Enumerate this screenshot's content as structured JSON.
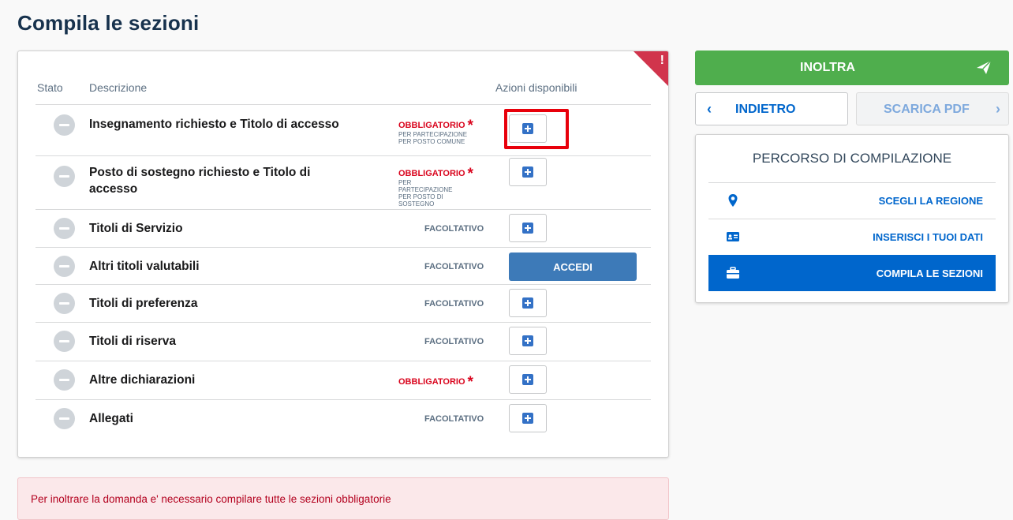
{
  "page": {
    "title": "Compila le sezioni"
  },
  "table": {
    "headers": {
      "stato": "Stato",
      "descrizione": "Descrizione",
      "azioni": "Azioni disponibili"
    },
    "rows": [
      {
        "label": "Insegnamento richiesto e Titolo di accesso",
        "tag": "OBBLIGATORIO",
        "required": true,
        "note": "PER PARTECIPAZIONE PER POSTO COMUNE",
        "action": "add",
        "highlighted": true
      },
      {
        "label": "Posto di sostegno richiesto e Titolo di accesso",
        "tag": "OBBLIGATORIO",
        "required": true,
        "note": "PER PARTECIPAZIONE PER POSTO DI SOSTEGNO",
        "action": "add"
      },
      {
        "label": "Titoli di Servizio",
        "tag": "FACOLTATIVO",
        "required": false,
        "action": "add"
      },
      {
        "label": "Altri titoli valutabili",
        "tag": "FACOLTATIVO",
        "required": false,
        "action": "button",
        "action_label": "ACCEDI"
      },
      {
        "label": "Titoli di preferenza",
        "tag": "FACOLTATIVO",
        "required": false,
        "action": "add"
      },
      {
        "label": "Titoli di riserva",
        "tag": "FACOLTATIVO",
        "required": false,
        "action": "add"
      },
      {
        "label": "Altre dichiarazioni",
        "tag": "OBBLIGATORIO",
        "required": true,
        "action": "add"
      },
      {
        "label": "Allegati",
        "tag": "FACOLTATIVO",
        "required": false,
        "action": "add"
      }
    ]
  },
  "required_star": "*",
  "corner_mark": "!",
  "alert": {
    "text": "Per inoltrare la domanda e' necessario compilare tutte le sezioni obbligatorie"
  },
  "sidebar": {
    "inoltra_label": "INOLTRA",
    "indietro_label": "INDIETRO",
    "scarica_label": "SCARICA PDF",
    "path_title": "PERCORSO DI COMPILAZIONE",
    "steps": [
      {
        "label": "SCEGLI LA REGIONE",
        "icon": "map-pin-icon",
        "active": false
      },
      {
        "label": "INSERISCI I TUOI DATI",
        "icon": "id-card-icon",
        "active": false
      },
      {
        "label": "COMPILA LE SEZIONI",
        "icon": "briefcase-icon",
        "active": true
      }
    ]
  },
  "colors": {
    "primary": "#0066cc",
    "success": "#4fae4d",
    "danger": "#d9041d",
    "title": "#17324d"
  }
}
